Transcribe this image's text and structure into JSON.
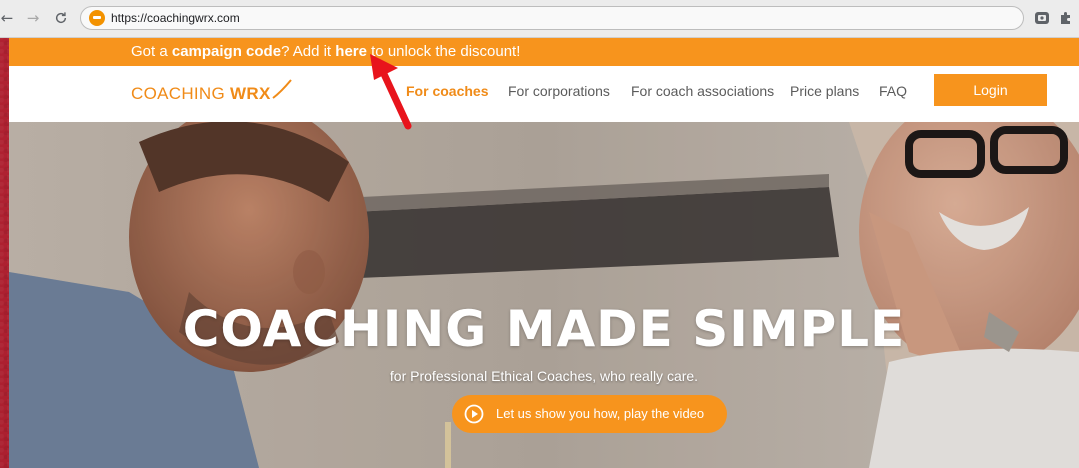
{
  "browser": {
    "url": "https://coachingwrx.com",
    "back_glyph": "←",
    "forward_glyph": "→"
  },
  "promo": {
    "prefix": "Got a ",
    "bold1": "campaign code",
    "middle": "? Add it ",
    "link": "here",
    "suffix": " to unlock the discount!"
  },
  "header": {
    "logo_main": "COACHING ",
    "logo_bold": "WRX",
    "nav": [
      "For coaches",
      "For corporations",
      "For coach associations",
      "Price plans",
      "FAQ"
    ],
    "login_label": "Login"
  },
  "hero": {
    "title": "COACHING MADE SIMPLE",
    "subtitle": "for Professional Ethical Coaches, who really care.",
    "video_button": "Let us show you how, play the video"
  },
  "colors": {
    "accent": "#f7941d",
    "logo": "#f08b18",
    "annotation": "#e8141c",
    "frame": "#a81e2c"
  },
  "icons": {
    "reload": "reload-icon",
    "play": "play-circle-icon",
    "ext1": "extension-icon",
    "ext2": "puzzle-icon"
  }
}
